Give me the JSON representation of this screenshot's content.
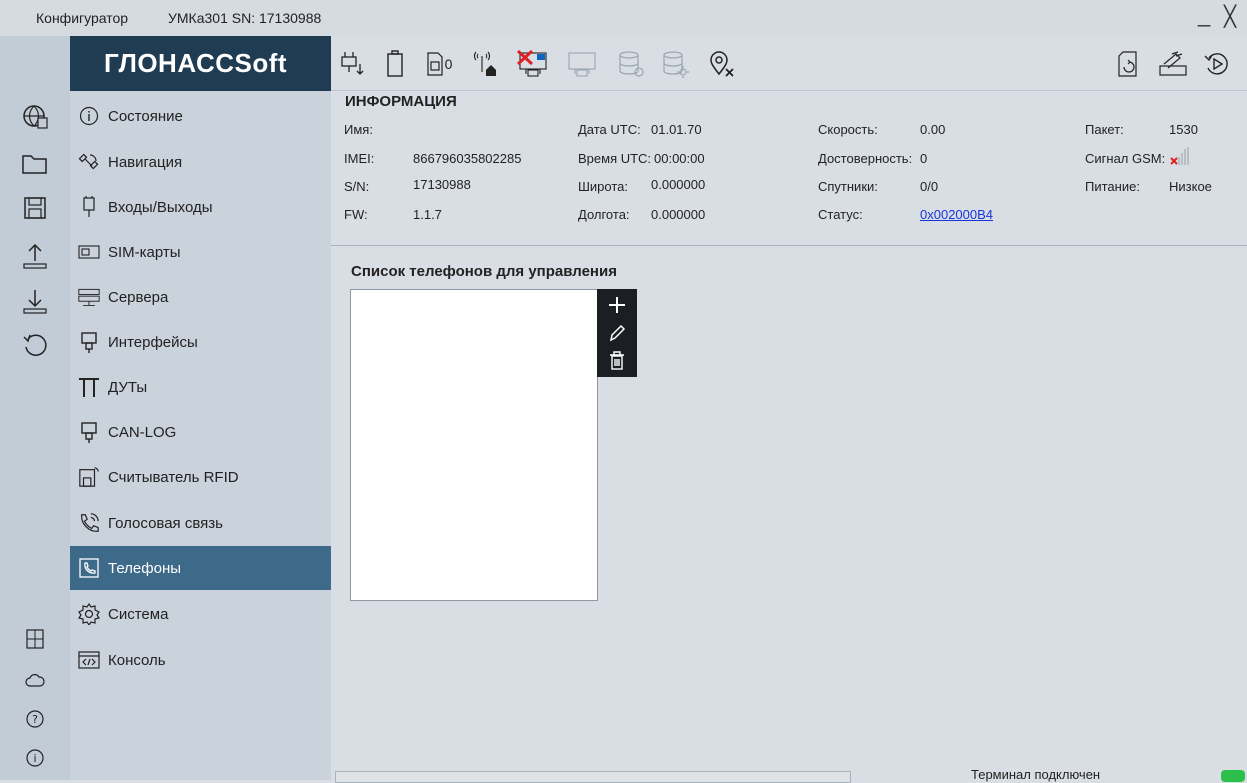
{
  "titlebar": {
    "app": "Конфигуратор",
    "device": "УМКа301 SN: 17130988",
    "minimize": "_",
    "close": "╳"
  },
  "logo": {
    "text": "ГЛОНАССSoft"
  },
  "leftbar": {
    "icons": [
      "globe-settings-icon",
      "folder-icon",
      "save-icon",
      "upload-icon",
      "download-icon",
      "reset-icon",
      "calculator-icon",
      "cloud-icon",
      "help-icon",
      "info-icon"
    ]
  },
  "nav": {
    "items": [
      {
        "label": "Состояние",
        "icon": "info-circle-icon"
      },
      {
        "label": "Навигация",
        "icon": "satellite-icon"
      },
      {
        "label": "Входы/Выходы",
        "icon": "plug-icon"
      },
      {
        "label": "SIM-карты",
        "icon": "sim-icon"
      },
      {
        "label": "Сервера",
        "icon": "server-icon"
      },
      {
        "label": "Интерфейсы",
        "icon": "connector-icon"
      },
      {
        "label": "ДУТы",
        "icon": "fuel-sensor-icon"
      },
      {
        "label": "CAN-LOG",
        "icon": "can-icon"
      },
      {
        "label": "Считыватель RFID",
        "icon": "rfid-icon"
      },
      {
        "label": "Голосовая связь",
        "icon": "phone-call-icon"
      },
      {
        "label": "Телефоны",
        "icon": "phone-icon"
      },
      {
        "label": "Система",
        "icon": "gear-icon"
      },
      {
        "label": "Консоль",
        "icon": "console-icon"
      }
    ],
    "active": "Телефоны"
  },
  "toolbar": {
    "badge_text": "0"
  },
  "info": {
    "title": "ИНФОРМАЦИЯ",
    "name_label": "Имя:",
    "name_value": "",
    "imei_label": "IMEI:",
    "imei_value": "866796035802285",
    "sn_label": "S/N:",
    "sn_value": "17130988",
    "fw_label": "FW:",
    "fw_value": "1.1.7",
    "date_label": "Дата UTC:",
    "date_value": "01.01.70",
    "time_label": "Время UTC:",
    "time_value": "00:00:00",
    "lat_label": "Широта:",
    "lat_value": "0.000000",
    "lon_label": "Долгота:",
    "lon_value": "0.000000",
    "speed_label": "Скорость:",
    "speed_value": "0.00",
    "valid_label": "Достоверность:",
    "valid_value": "0",
    "sat_label": "Спутники:",
    "sat_value": "0/0",
    "status_label": "Статус:",
    "status_value": "0x002000B4",
    "packet_label": "Пакет:",
    "packet_value": "1530",
    "gsm_label": "Сигнал GSM:",
    "power_label": "Питание:",
    "power_value": "Низкое"
  },
  "phones": {
    "title": "Список телефонов для управления",
    "items": []
  },
  "status": {
    "text": "Терминал подключен",
    "led_color": "#2cc04a"
  },
  "colors": {
    "sidebar_active": "#3e6a8a",
    "logo_bg": "#1f3c52",
    "link": "#1a34d8"
  }
}
